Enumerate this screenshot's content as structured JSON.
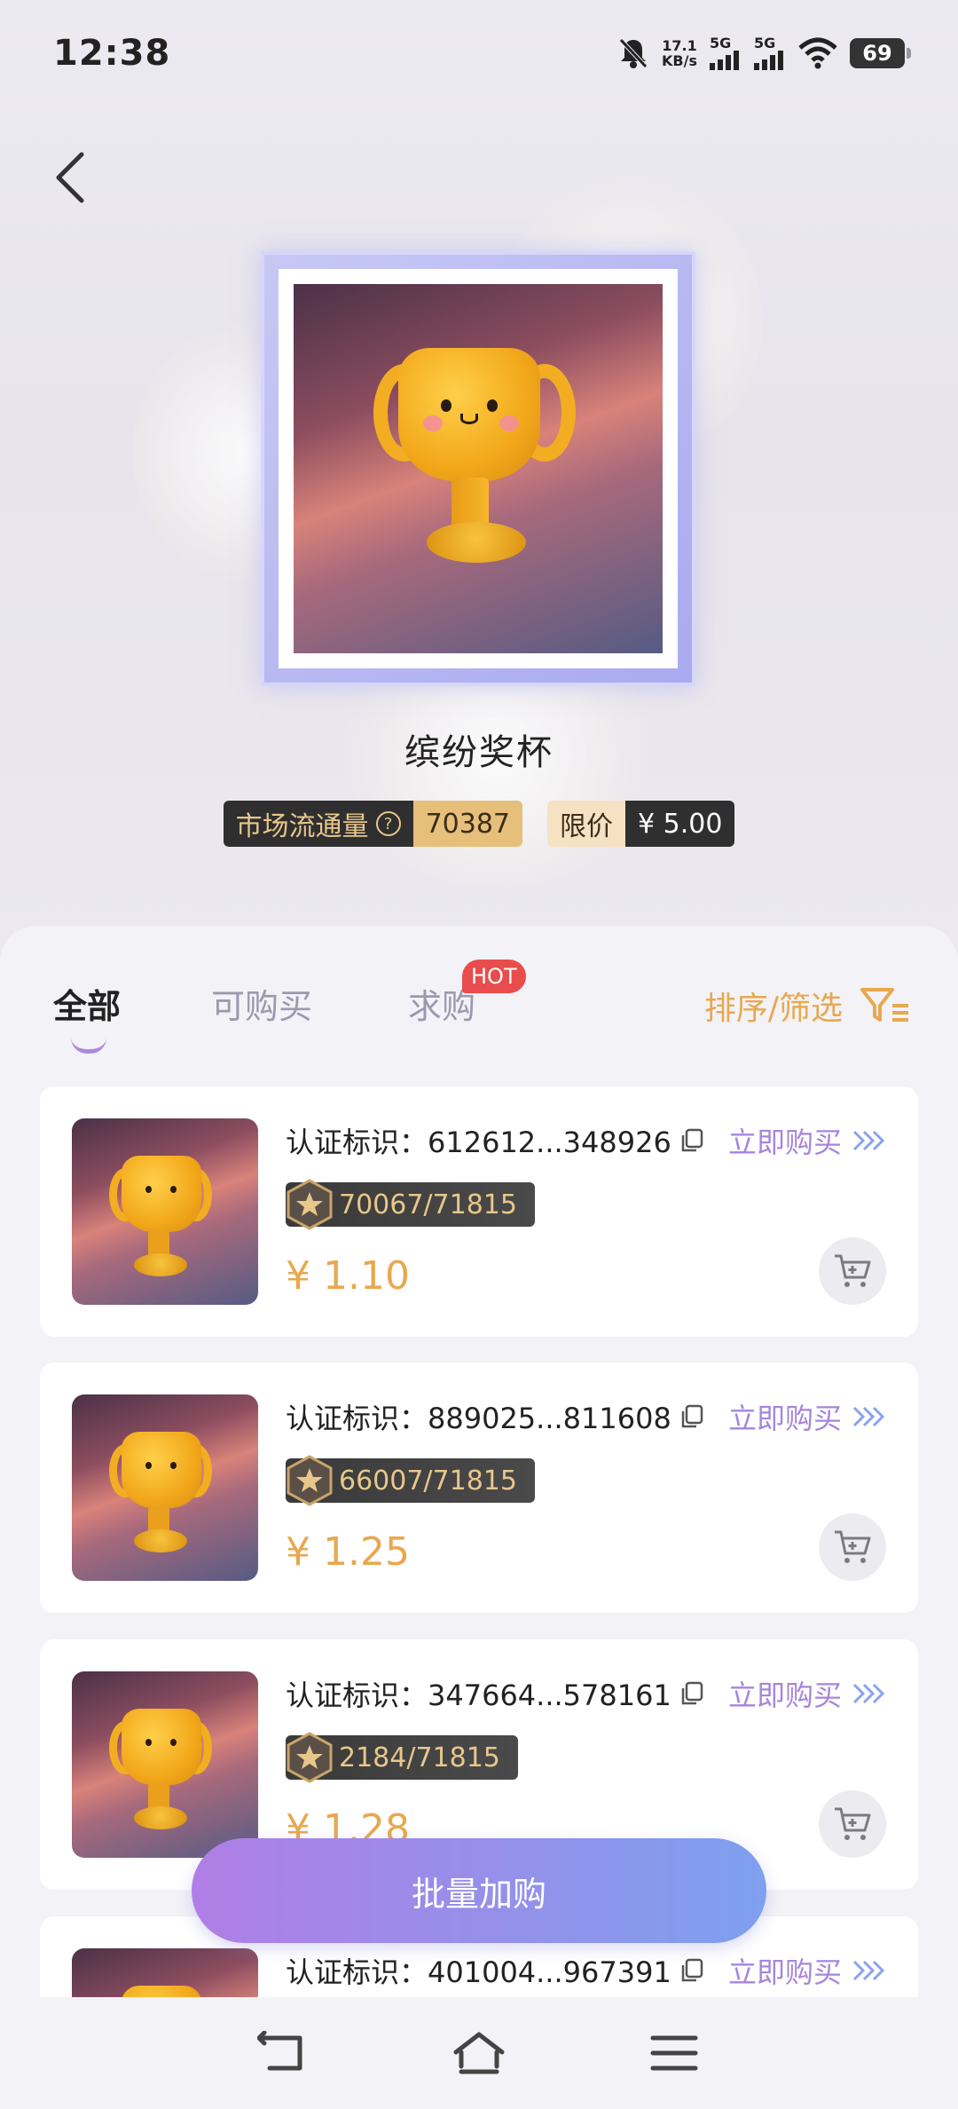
{
  "status_bar": {
    "time": "12:38",
    "net_speed_value": "17.1",
    "net_speed_unit": "KB/s",
    "signal1": "5G",
    "signal2": "5G",
    "battery": "69"
  },
  "header": {
    "title": "缤纷奖杯",
    "circulation_label": "市场流通量",
    "circulation_value": "70387",
    "limit_label": "限价",
    "limit_value": "¥ 5.00"
  },
  "tabs": [
    {
      "label": "全部"
    },
    {
      "label": "可购买"
    },
    {
      "label": "求购"
    }
  ],
  "hot_badge": "HOT",
  "sort_label": "排序/筛选",
  "listings": [
    {
      "cert": "认证标识：612612...348926",
      "edition": "70067/71815",
      "price": "¥ 1.10",
      "buy": "立即购买"
    },
    {
      "cert": "认证标识：889025...811608",
      "edition": "66007/71815",
      "price": "¥ 1.25",
      "buy": "立即购买"
    },
    {
      "cert": "认证标识：347664...578161",
      "edition": "2184/71815",
      "price": "¥ 1.28",
      "buy": "立即购买"
    },
    {
      "cert": "认证标识：401004...967391",
      "edition": "",
      "price": "",
      "buy": "立即购买"
    }
  ],
  "batch_button": "批量加购",
  "colors": {
    "accent_purple": "#a685dc",
    "accent_gold": "#e8a850",
    "batch_gradient_start": "#b07ee6",
    "batch_gradient_end": "#7ea0ee"
  }
}
